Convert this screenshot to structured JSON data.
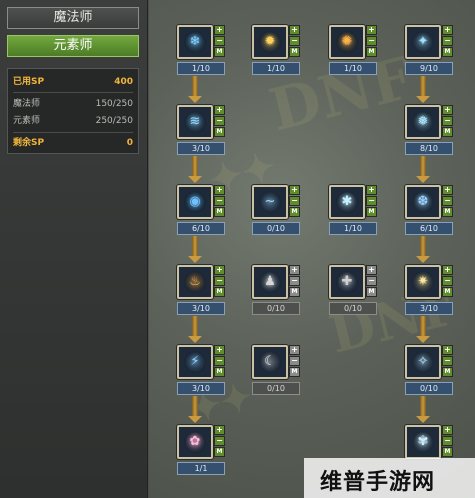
{
  "sidebar": {
    "tab_main": "魔法师",
    "tab_sub": "元素师",
    "sp": {
      "used_label": "已用SP",
      "used_value": "400",
      "rows": [
        {
          "label": "魔法师",
          "value": "150/250"
        },
        {
          "label": "元素师",
          "value": "250/250"
        }
      ],
      "remain_label": "剩余SP",
      "remain_value": "0"
    }
  },
  "tree": {
    "button_plus": "+",
    "button_minus": "−",
    "button_m": "M",
    "skills": [
      {
        "level": "1/10",
        "icon": "ice-crystal-icon",
        "glyph": "❄",
        "color": "#7ecfff",
        "on": true
      },
      {
        "level": "1/10",
        "icon": "fire-orb-icon",
        "glyph": "✹",
        "color": "#ffd15a",
        "on": true
      },
      {
        "level": "1/10",
        "icon": "flame-burst-icon",
        "glyph": "✺",
        "color": "#ffb347",
        "on": true
      },
      {
        "level": "9/10",
        "icon": "ice-shard-icon",
        "glyph": "✦",
        "color": "#9ee0ff",
        "on": true
      },
      {
        "level": "3/10",
        "icon": "frost-wave-icon",
        "glyph": "≋",
        "color": "#8fd6ff",
        "on": true
      },
      {
        "level": "8/10",
        "icon": "ice-orb-icon",
        "glyph": "❅",
        "color": "#aee8ff",
        "on": true
      },
      {
        "level": "6/10",
        "icon": "water-drop-icon",
        "glyph": "◉",
        "color": "#6fc1ff",
        "on": true
      },
      {
        "level": "0/10",
        "icon": "wind-swirl-icon",
        "glyph": "~",
        "color": "#9fd8ff",
        "on": true
      },
      {
        "level": "1/10",
        "icon": "ice-spikes-icon",
        "glyph": "✱",
        "color": "#c5eeff",
        "on": true
      },
      {
        "level": "6/10",
        "icon": "blizzard-icon",
        "glyph": "❆",
        "color": "#9cd3ff",
        "on": true
      },
      {
        "level": "3/10",
        "icon": "fire-pillar-icon",
        "glyph": "♨",
        "color": "#ffae45",
        "on": true
      },
      {
        "level": "0/10",
        "icon": "shadow-figure-icon",
        "glyph": "♟",
        "color": "#d8d8d8",
        "on": false
      },
      {
        "level": "0/10",
        "icon": "rune-circle-icon",
        "glyph": "✚",
        "color": "#cfcfcf",
        "on": false
      },
      {
        "level": "3/10",
        "icon": "light-burst-icon",
        "glyph": "✷",
        "color": "#ffe59a",
        "on": true
      },
      {
        "level": "3/10",
        "icon": "thunder-bird-icon",
        "glyph": "⚡",
        "color": "#8ecfff",
        "on": true
      },
      {
        "level": "0/10",
        "icon": "crescent-moon-icon",
        "glyph": "☾",
        "color": "#e6e6e6",
        "on": false
      },
      {
        "level": "0/10",
        "icon": "ice-giant-icon",
        "glyph": "✧",
        "color": "#b4e4ff",
        "on": true
      },
      {
        "level": "1/1",
        "icon": "pink-spirit-icon",
        "glyph": "✿",
        "color": "#ffb6d9",
        "on": true
      },
      {
        "level": "",
        "icon": "ice-flower-icon",
        "glyph": "✾",
        "color": "#cdeeff",
        "on": true
      }
    ]
  },
  "watermark": {
    "text": "维普手游网"
  },
  "colors": {
    "accent_green": "#5f8d2c",
    "sp_orange": "#f0b43a",
    "level_blue": "#34506e"
  }
}
